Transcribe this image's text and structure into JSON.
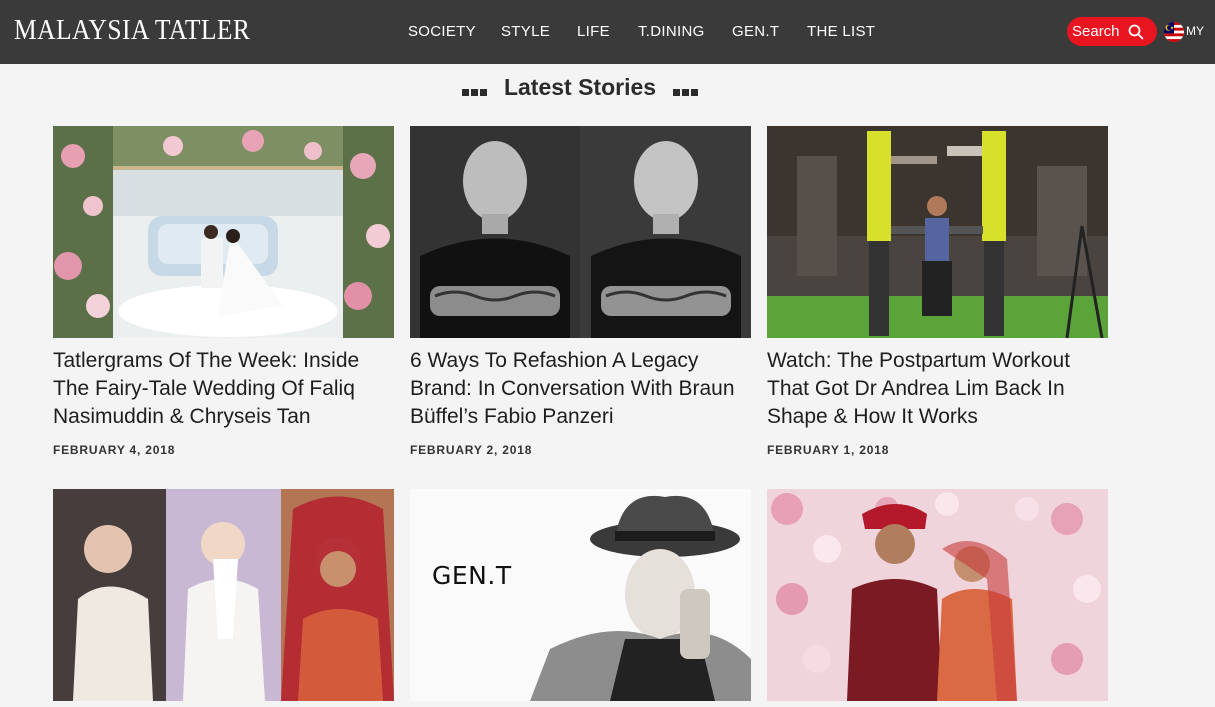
{
  "header": {
    "logo": "MALAYSIA TATLER",
    "nav": [
      "SOCIETY",
      "STYLE",
      "LIFE",
      "T.DINING",
      "GEN.T",
      "THE LIST"
    ],
    "search_label": "Search",
    "search_icon": "search-icon",
    "region_flag_icon": "malaysia-flag-icon",
    "region_label": "MY"
  },
  "section": {
    "title": "Latest Stories"
  },
  "stories": [
    {
      "title": "Tatlergrams Of The Week: Inside The Fairy-Tale Wedding Of Faliq Nasimuddin & Chryseis Tan",
      "date": "FEBRUARY 4, 2018"
    },
    {
      "title": "6 Ways To Refashion A Legacy Brand: In Conversation With Braun Büffel’s Fabio Panzeri",
      "date": "FEBRUARY 2, 2018"
    },
    {
      "title": "Watch: The Postpartum Workout That Got Dr Andrea Lim Back In Shape & How It Works",
      "date": "FEBRUARY 1, 2018"
    },
    {
      "title": "",
      "date": ""
    },
    {
      "title": "",
      "date": "",
      "image_text": "GEN.T"
    },
    {
      "title": "",
      "date": ""
    }
  ],
  "colors": {
    "header_bg": "#3a3a3a",
    "search_bg": "#e8141f",
    "page_bg": "#f4f4f4"
  }
}
